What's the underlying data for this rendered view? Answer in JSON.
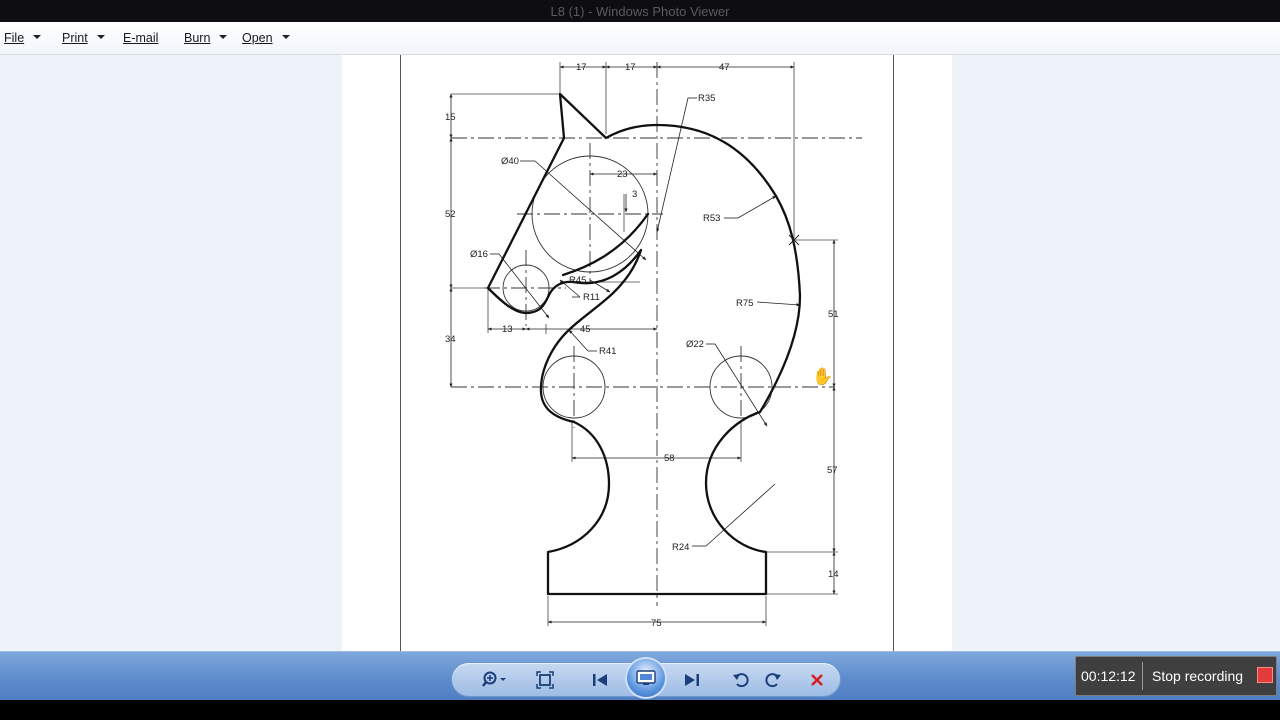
{
  "window": {
    "title": "L8 (1) - Windows Photo Viewer"
  },
  "menu": [
    {
      "label": "File",
      "has_dropdown": true
    },
    {
      "label": "Print",
      "has_dropdown": true
    },
    {
      "label": "E-mail",
      "has_dropdown": false
    },
    {
      "label": "Burn",
      "has_dropdown": true
    },
    {
      "label": "Open",
      "has_dropdown": true
    }
  ],
  "drawing": {
    "dims": {
      "d17a": "17",
      "d17b": "17",
      "d47": "47",
      "d15": "15",
      "d52": "52",
      "d34": "34",
      "d23": "23",
      "d3": "3",
      "d13": "13",
      "d45": "45",
      "d51": "51",
      "d57": "57",
      "d58": "58",
      "d14": "14",
      "d75": "75"
    },
    "labels": {
      "r35": "R35",
      "o40": "Ø40",
      "r53": "R53",
      "o16": "Ø16",
      "r45": "R45",
      "r11": "R11",
      "r75": "R75",
      "r41": "R41",
      "o22": "Ø22",
      "r24": "R24"
    }
  },
  "toolbar": {
    "buttons": [
      "zoom-icon",
      "fit-to-window-icon",
      "previous-icon",
      "slideshow-icon",
      "next-icon",
      "rotate-counterclockwise-icon",
      "rotate-clockwise-icon",
      "delete-icon"
    ]
  },
  "recording": {
    "time": "00:12:12",
    "stop_label": "Stop recording"
  },
  "colors": {
    "toolbar": "#5d8bcc",
    "viewer_bg": "#eef3fa",
    "record_red": "#e23b3b"
  }
}
